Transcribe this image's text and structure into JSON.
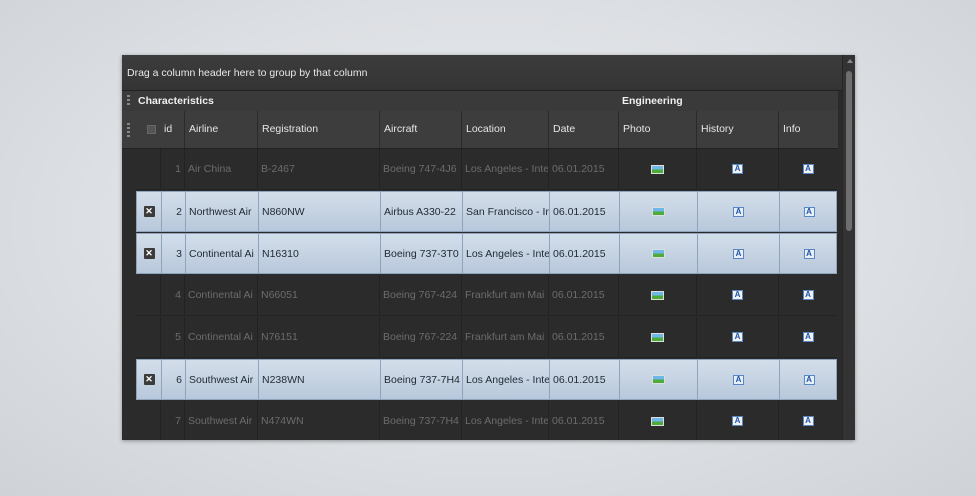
{
  "grid": {
    "group_panel_text": "Drag a column header here to group by that column",
    "bands": {
      "characteristics": "Characteristics",
      "engineering": "Engineering"
    },
    "columns": {
      "id": "id",
      "airline": "Airline",
      "registration": "Registration",
      "aircraft": "Aircraft",
      "location": "Location",
      "date": "Date",
      "photo": "Photo",
      "history": "History",
      "info": "Info"
    },
    "rows": [
      {
        "selected": false,
        "id": "1",
        "airline": "Air China",
        "registration": "B-2467",
        "aircraft": "Boeing 747-4J6",
        "location": "Los Angeles - Inte",
        "date": "06.01.2015"
      },
      {
        "selected": true,
        "id": "2",
        "airline": "Northwest Air",
        "registration": "N860NW",
        "aircraft": "Airbus A330-22",
        "location": "San Francisco - Ir",
        "date": "06.01.2015"
      },
      {
        "selected": true,
        "id": "3",
        "airline": "Continental Ai",
        "registration": "N16310",
        "aircraft": "Boeing 737-3T0",
        "location": "Los Angeles - Inte",
        "date": "06.01.2015"
      },
      {
        "selected": false,
        "id": "4",
        "airline": "Continental Ai",
        "registration": "N66051",
        "aircraft": "Boeing 767-424",
        "location": "Frankfurt am Mai",
        "date": "06.01.2015"
      },
      {
        "selected": false,
        "id": "5",
        "airline": "Continental Ai",
        "registration": "N76151",
        "aircraft": "Boeing 767-224",
        "location": "Frankfurt am Mai",
        "date": "06.01.2015"
      },
      {
        "selected": true,
        "id": "6",
        "airline": "Southwest Air",
        "registration": "N238WN",
        "aircraft": "Boeing 737-7H4",
        "location": "Los Angeles - Inte",
        "date": "06.01.2015"
      },
      {
        "selected": false,
        "id": "7",
        "airline": "Southwest Air",
        "registration": "N474WN",
        "aircraft": "Boeing 737-7H4",
        "location": "Los Angeles - Inte",
        "date": "06.01.2015"
      }
    ],
    "colors": {
      "selected_row": "#c6d4e4",
      "grid_background": "#2b2b2b"
    },
    "icons": {
      "photo": "photo-icon",
      "history": "document-icon",
      "info": "document-icon",
      "row_check": "close-icon"
    }
  }
}
